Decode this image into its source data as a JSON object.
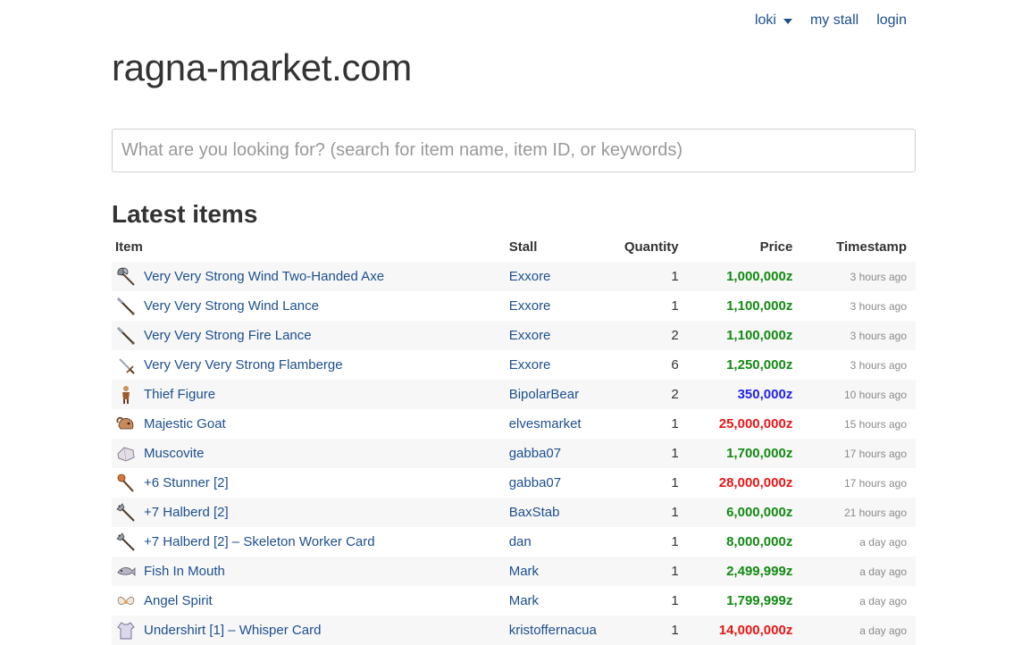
{
  "nav": {
    "user_label": "loki",
    "my_stall_label": "my stall",
    "login_label": "login"
  },
  "site_title": "ragna-market.com",
  "search": {
    "placeholder": "What are you looking for? (search for item name, item ID, or keywords)",
    "value": ""
  },
  "latest": {
    "title": "Latest items",
    "columns": {
      "item": "Item",
      "stall": "Stall",
      "quantity": "Quantity",
      "price": "Price",
      "timestamp": "Timestamp"
    },
    "rows": [
      {
        "item": "Very Very Strong Wind Two-Handed Axe",
        "icon": "axe-icon",
        "stall": "Exxore",
        "quantity": "1",
        "price": "1,000,000z",
        "price_color": "green",
        "timestamp": "3 hours ago"
      },
      {
        "item": "Very Very Strong Wind Lance",
        "icon": "lance-icon",
        "stall": "Exxore",
        "quantity": "1",
        "price": "1,100,000z",
        "price_color": "green",
        "timestamp": "3 hours ago"
      },
      {
        "item": "Very Very Strong Fire Lance",
        "icon": "lance-icon",
        "stall": "Exxore",
        "quantity": "2",
        "price": "1,100,000z",
        "price_color": "green",
        "timestamp": "3 hours ago"
      },
      {
        "item": "Very Very Very Strong Flamberge",
        "icon": "sword-icon",
        "stall": "Exxore",
        "quantity": "6",
        "price": "1,250,000z",
        "price_color": "green",
        "timestamp": "3 hours ago"
      },
      {
        "item": "Thief Figure",
        "icon": "figure-icon",
        "stall": "BipolarBear",
        "quantity": "2",
        "price": "350,000z",
        "price_color": "blue",
        "timestamp": "10 hours ago"
      },
      {
        "item": "Majestic Goat",
        "icon": "goat-helm-icon",
        "stall": "elvesmarket",
        "quantity": "1",
        "price": "25,000,000z",
        "price_color": "red",
        "timestamp": "15 hours ago"
      },
      {
        "item": "Muscovite",
        "icon": "mineral-icon",
        "stall": "gabba07",
        "quantity": "1",
        "price": "1,700,000z",
        "price_color": "green",
        "timestamp": "17 hours ago"
      },
      {
        "item": "+6 Stunner [2]",
        "icon": "club-icon",
        "stall": "gabba07",
        "quantity": "1",
        "price": "28,000,000z",
        "price_color": "red",
        "timestamp": "17 hours ago"
      },
      {
        "item": "+7 Halberd [2]",
        "icon": "halberd-icon",
        "stall": "BaxStab",
        "quantity": "1",
        "price": "6,000,000z",
        "price_color": "green",
        "timestamp": "21 hours ago"
      },
      {
        "item": "+7 Halberd [2] – Skeleton Worker Card",
        "icon": "halberd-icon",
        "stall": "dan",
        "quantity": "1",
        "price": "8,000,000z",
        "price_color": "green",
        "timestamp": "a day ago"
      },
      {
        "item": "Fish In Mouth",
        "icon": "fish-icon",
        "stall": "Mark",
        "quantity": "1",
        "price": "2,499,999z",
        "price_color": "green",
        "timestamp": "a day ago"
      },
      {
        "item": "Angel Spirit",
        "icon": "angel-spirit-icon",
        "stall": "Mark",
        "quantity": "1",
        "price": "1,799,999z",
        "price_color": "green",
        "timestamp": "a day ago"
      },
      {
        "item": "Undershirt [1] – Whisper Card",
        "icon": "undershirt-icon",
        "stall": "kristoffernacua",
        "quantity": "1",
        "price": "14,000,000z",
        "price_color": "red",
        "timestamp": "a day ago"
      }
    ]
  },
  "colors": {
    "link": "#1d4f8f",
    "price_green": "#118a11",
    "price_blue": "#2222ee",
    "price_red": "#e81515",
    "row_stripe": "#f7f7f7"
  }
}
